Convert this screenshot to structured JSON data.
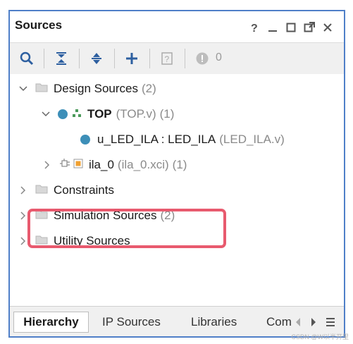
{
  "panel": {
    "title": "Sources",
    "window_controls": [
      "help-icon",
      "minimize-icon",
      "maximize-icon",
      "float-icon",
      "close-icon"
    ]
  },
  "toolbar": {
    "icons": [
      "search-icon",
      "collapse-all-icon",
      "expand-all-icon",
      "add-icon",
      "properties-icon",
      "status-icon"
    ],
    "count": "0"
  },
  "tree": {
    "design_sources": {
      "label": "Design Sources",
      "count": "(2)"
    },
    "top": {
      "label": "TOP",
      "file": "(TOP.v)",
      "count": "(1)"
    },
    "u_led_ila": {
      "label": "u_LED_ILA : LED_ILA",
      "file": "(LED_ILA.v)"
    },
    "ila_0": {
      "label": "ila_0",
      "file": "(ila_0.xci)",
      "count": "(1)"
    },
    "constraints": {
      "label": "Constraints"
    },
    "simulation_sources": {
      "label": "Simulation Sources",
      "count": "(2)"
    },
    "utility_sources": {
      "label": "Utility Sources"
    }
  },
  "tabs": [
    {
      "label": "Hierarchy",
      "active": true
    },
    {
      "label": "IP Sources"
    },
    {
      "label": "Libraries"
    },
    {
      "label": "Com"
    }
  ],
  "watermark": "CSDN @W以半开里",
  "colors": {
    "accent": "#4f7fc8",
    "highlight": "#e85a6e",
    "node_dot": "#3d8fb8",
    "ip_orange": "#f0a030"
  }
}
